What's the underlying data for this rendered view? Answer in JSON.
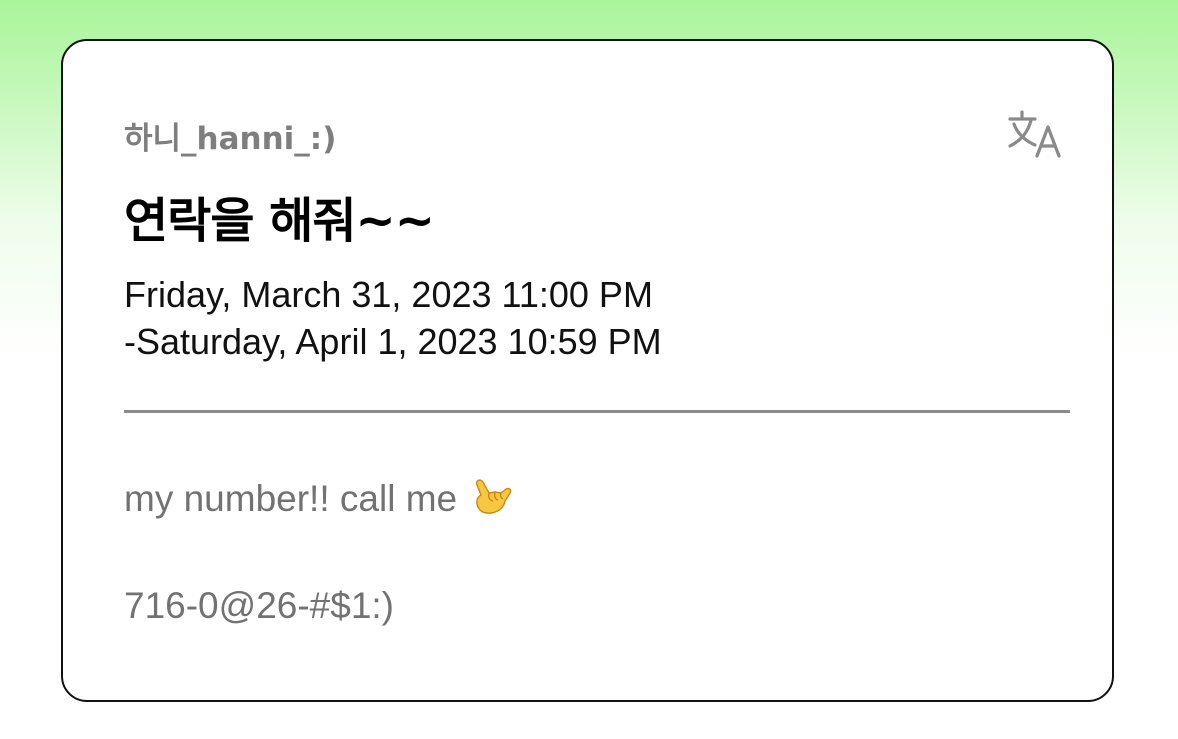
{
  "event": {
    "author": "하니_hanni_:)",
    "title": "연락을 해줘~~",
    "date_start": "Friday, March 31, 2023 11:00 PM",
    "date_end": "-Saturday, April 1, 2023 10:59 PM",
    "message_line": "my number!! call me",
    "message_emoji": "call-me-hand-emoji",
    "phone": "716-0@26-#$1:)"
  },
  "icons": {
    "translate": "translate-icon"
  },
  "colors": {
    "background_top": "#a9f59a",
    "card_border": "#111111",
    "muted_text": "#7e7e7e",
    "divider": "#8a8a8a"
  }
}
